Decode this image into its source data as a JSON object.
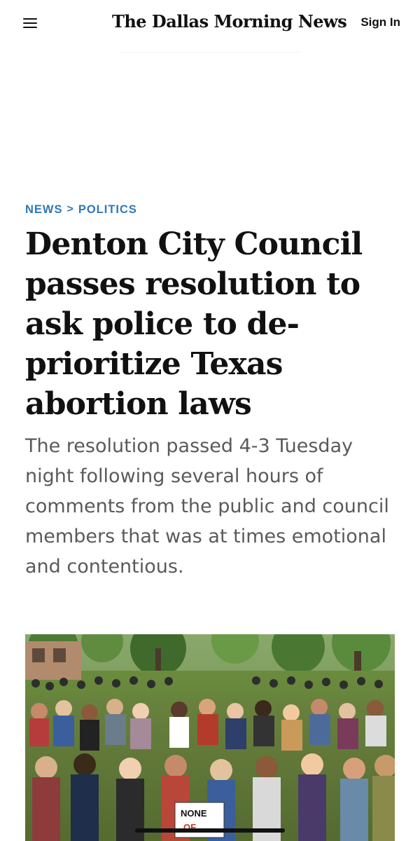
{
  "header": {
    "logo_text": "The Dallas Morning News",
    "sign_in_label": "Sign In",
    "menu_icon": "hamburger-menu-icon"
  },
  "breadcrumb": {
    "section": "NEWS",
    "separator": ">",
    "subsection": "POLITICS"
  },
  "article": {
    "headline": "Denton City Council passes resolution to ask police to de-prioritize Texas abortion laws",
    "dek": "The resolution passed 4-3 Tuesday night following several hours of comments from the public and council members that was at times emotional and contentious.",
    "photo_alt": "crowd of protesters gathered in a park",
    "sign_text_1": "NONE",
    "sign_text_2": "OF"
  },
  "colors": {
    "accent": "#2f78b7",
    "text": "#111111",
    "dek": "#5a5a5a",
    "background": "#ffffff"
  }
}
